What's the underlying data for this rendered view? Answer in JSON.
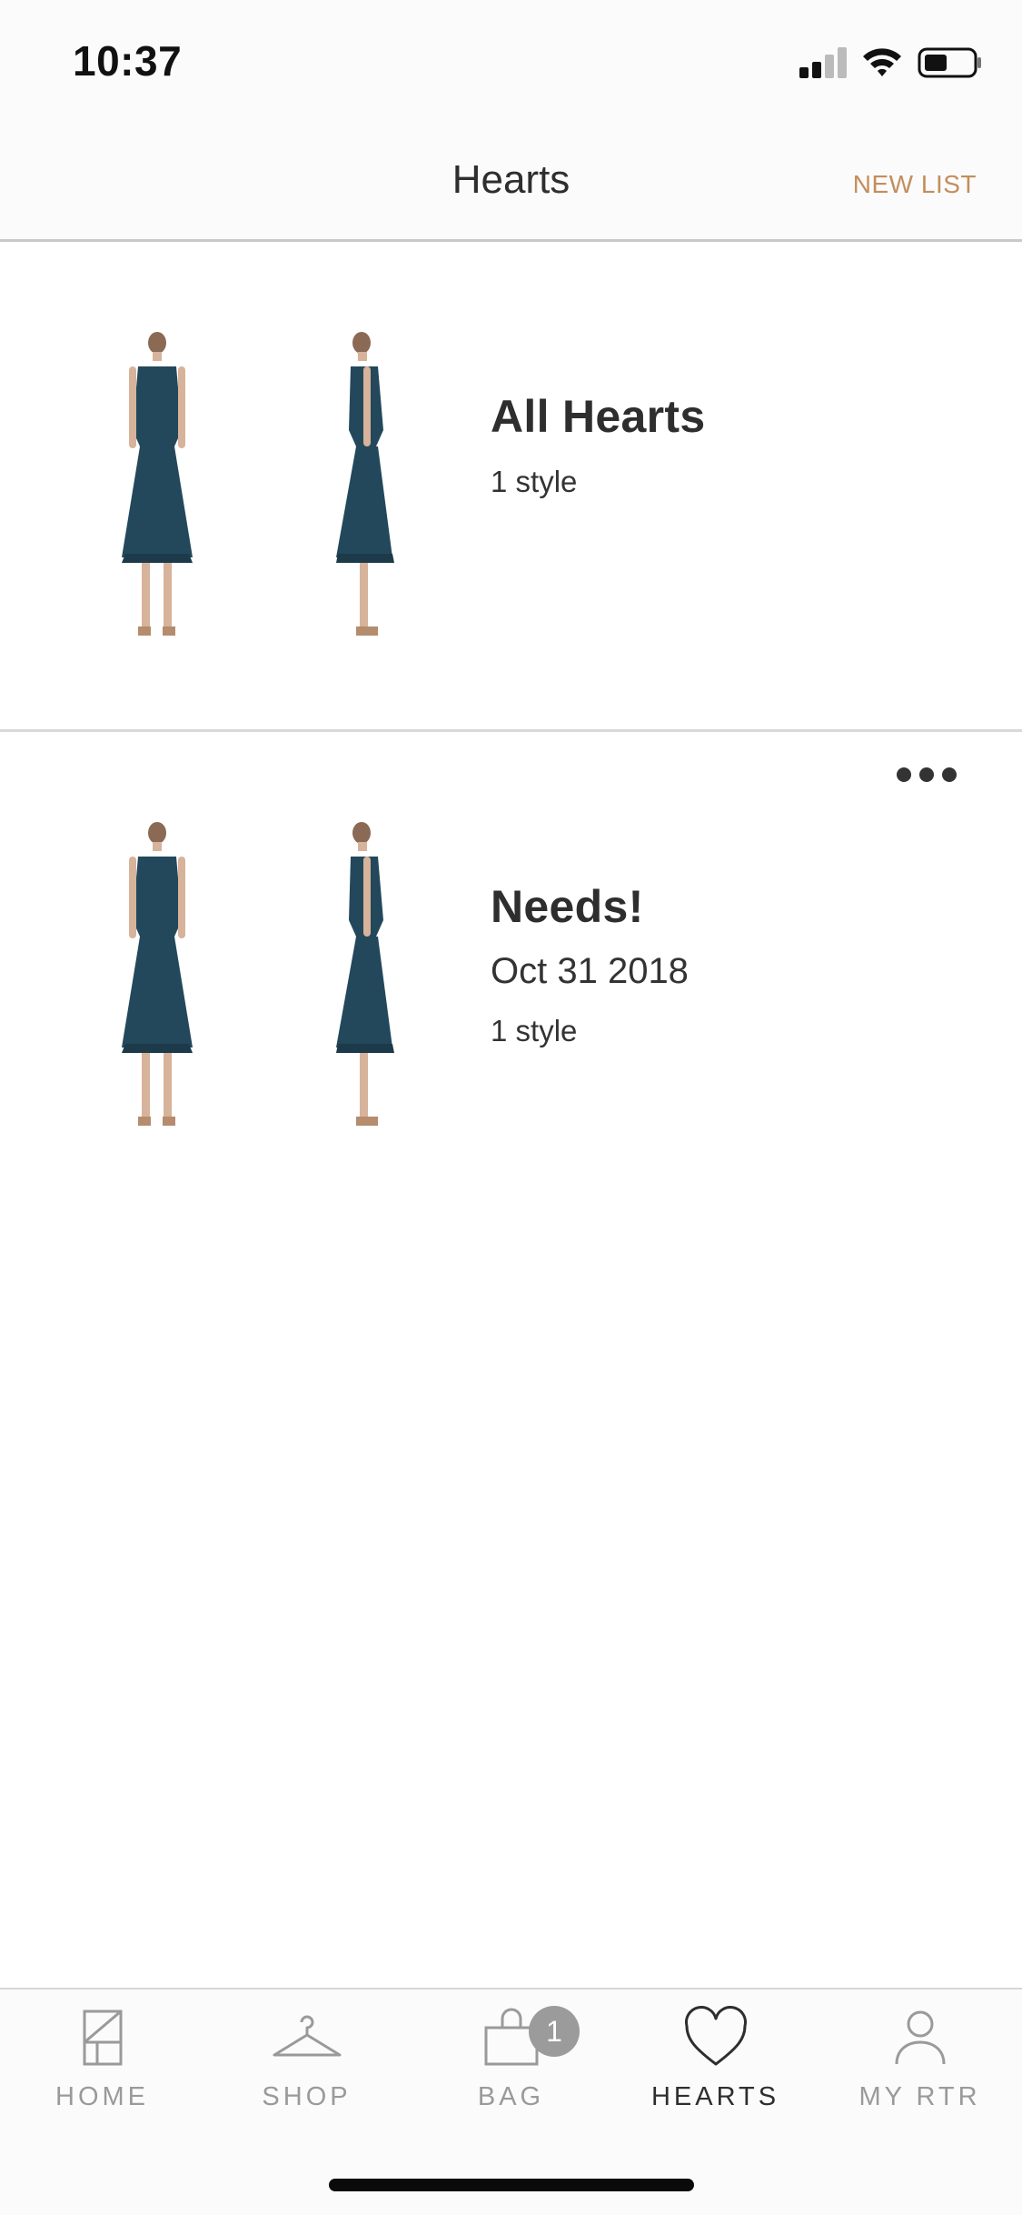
{
  "status_bar": {
    "time": "10:37"
  },
  "header": {
    "title": "Hearts",
    "new_list_label": "NEW LIST"
  },
  "lists": [
    {
      "title": "All Hearts",
      "date": "",
      "count": "1 style"
    },
    {
      "title": "Needs!",
      "date": "Oct 31 2018",
      "count": "1 style"
    }
  ],
  "tab_bar": {
    "tabs": [
      {
        "label": "HOME",
        "icon": "home-icon"
      },
      {
        "label": "SHOP",
        "icon": "hanger-icon"
      },
      {
        "label": "BAG",
        "icon": "bag-icon",
        "badge": "1"
      },
      {
        "label": "HEARTS",
        "icon": "heart-icon",
        "active": true
      },
      {
        "label": "MY RTR",
        "icon": "person-icon"
      }
    ]
  },
  "colors": {
    "accent": "#c38e5c",
    "dress": "#23485b",
    "text": "#2e2e2e",
    "inactive": "#9a9a9a"
  }
}
